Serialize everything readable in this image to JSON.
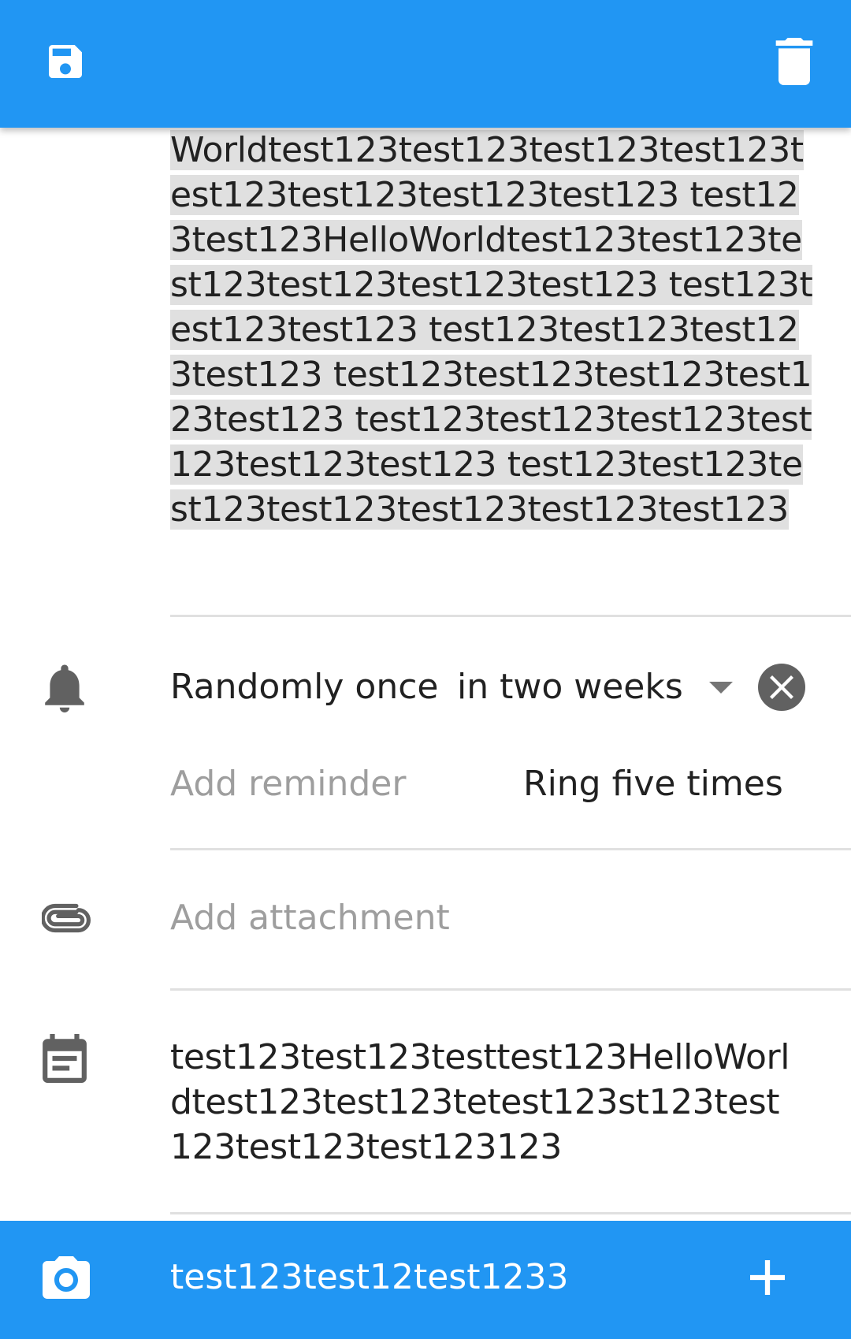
{
  "topbar": {
    "save_icon": "save-icon",
    "delete_icon": "delete-icon",
    "color": "#2196F3"
  },
  "note": {
    "body_text": "Worldtest123test123test123test123test123test123test123test123 test123test123HelloWorldtest123test123test123test123test123test123 test123test123test123  test123test123test123test123  test123test123test123test123test123  test123test123test123test123test123test123  test123test123test123test123test123test123test123"
  },
  "reminder": {
    "icon": "bell-icon",
    "label": "Randomly once",
    "frequency": "in two weeks",
    "clear_icon": "close-circle-icon",
    "add_placeholder": "Add reminder",
    "ring": "Ring five times"
  },
  "attachment": {
    "icon": "paperclip-icon",
    "placeholder": "Add attachment"
  },
  "description": {
    "icon": "event-note-icon",
    "text": "test123test123testtest123HelloWorldtest123test123tetest123st123test123test123test123123"
  },
  "bottombar": {
    "camera_icon": "camera-icon",
    "title": "test123test12test1233",
    "add_icon": "plus-icon"
  }
}
